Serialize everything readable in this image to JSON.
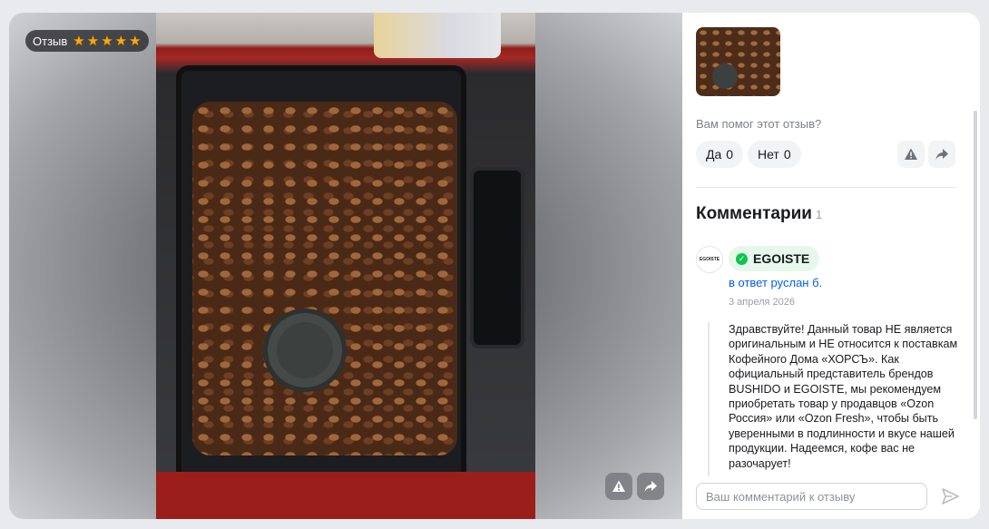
{
  "review": {
    "badge_label": "Отзыв",
    "rating": 5,
    "stars": [
      "★",
      "★",
      "★",
      "★",
      "★"
    ]
  },
  "panel": {
    "helpful_question": "Вам помог этот отзыв?",
    "yes_label": "Да",
    "yes_count": "0",
    "no_label": "Нет",
    "no_count": "0"
  },
  "comments": {
    "title": "Комментарии",
    "count": "1",
    "items": [
      {
        "avatar_text": "EGOISTE",
        "author": "EGOISTE",
        "verified_icon": "check-icon",
        "reply_to": "в ответ руслан б.",
        "date": "3 апреля 2026",
        "text": "Здравствуйте! Данный товар НЕ является оригинальным и НЕ относится к поставкам Кофейного Дома «ХОРСЪ». Как официальный представитель брендов BUSHIDO и EGOISTE, мы рекомендуем приобретать товар у продавцов «Ozon Россия» или «Ozon Fresh», чтобы быть уверенными в подлинности и вкусе нашей продукции. Надеемся, кофе вас не разочарует!"
      }
    ],
    "input_placeholder": "Ваш комментарий к отзыву"
  },
  "icons": {
    "report": "warning-icon",
    "share": "share-icon",
    "send": "send-icon"
  },
  "colors": {
    "accent_blue": "#005bff",
    "star": "#ffa800",
    "verified_green": "#10c44c"
  }
}
